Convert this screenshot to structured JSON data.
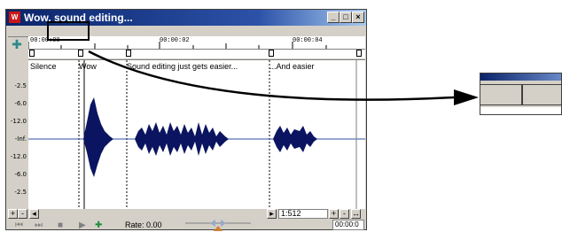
{
  "window": {
    "title": "Wow, sound editing...",
    "app_icon": "sound-forge-icon",
    "controls": {
      "minimize": "_",
      "maximize": "□",
      "close": "×"
    }
  },
  "timeline": {
    "ticks": [
      "00:00:00",
      "00:00:02",
      "00:00:04"
    ]
  },
  "regions": [
    {
      "label": "Silence"
    },
    {
      "label": "Wow"
    },
    {
      "label": "Sound editing just gets easier..."
    },
    {
      "label": "...And easier"
    }
  ],
  "amplitude_axis": [
    "-2.5",
    "-6.0",
    "-12.0",
    "-Inf.",
    "-12.0",
    "-6.0",
    "-2.5"
  ],
  "scrollbar": {
    "zoom_ratio": "1:512",
    "zoom_in": "+",
    "zoom_out": "-"
  },
  "transport": {
    "rate_label": "Rate: 0.00",
    "time": "00:00:0"
  },
  "colors": {
    "waveform": "#0a1460",
    "titlebar": "#0a246a",
    "arrow": "#000000"
  }
}
